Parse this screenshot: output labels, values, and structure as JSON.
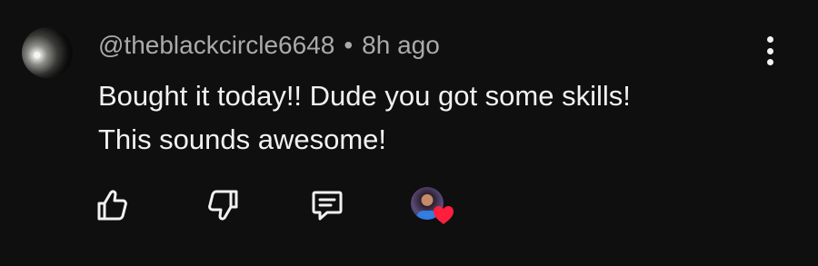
{
  "comment": {
    "author": "@theblackcircle6648",
    "separator": "•",
    "time": "8h ago",
    "text_line1": "Bought it today!! Dude you got some skills!",
    "text_line2": "This sounds awesome!"
  },
  "icons": {
    "more": "more-vert-icon",
    "like": "thumbs-up-icon",
    "dislike": "thumbs-down-icon",
    "reply": "reply-icon",
    "creator_heart": "heart-icon"
  },
  "colors": {
    "background": "#0f0f0f",
    "text": "#f1f1f1",
    "meta": "#aaaaaa",
    "heart": "#ff1f3d"
  }
}
